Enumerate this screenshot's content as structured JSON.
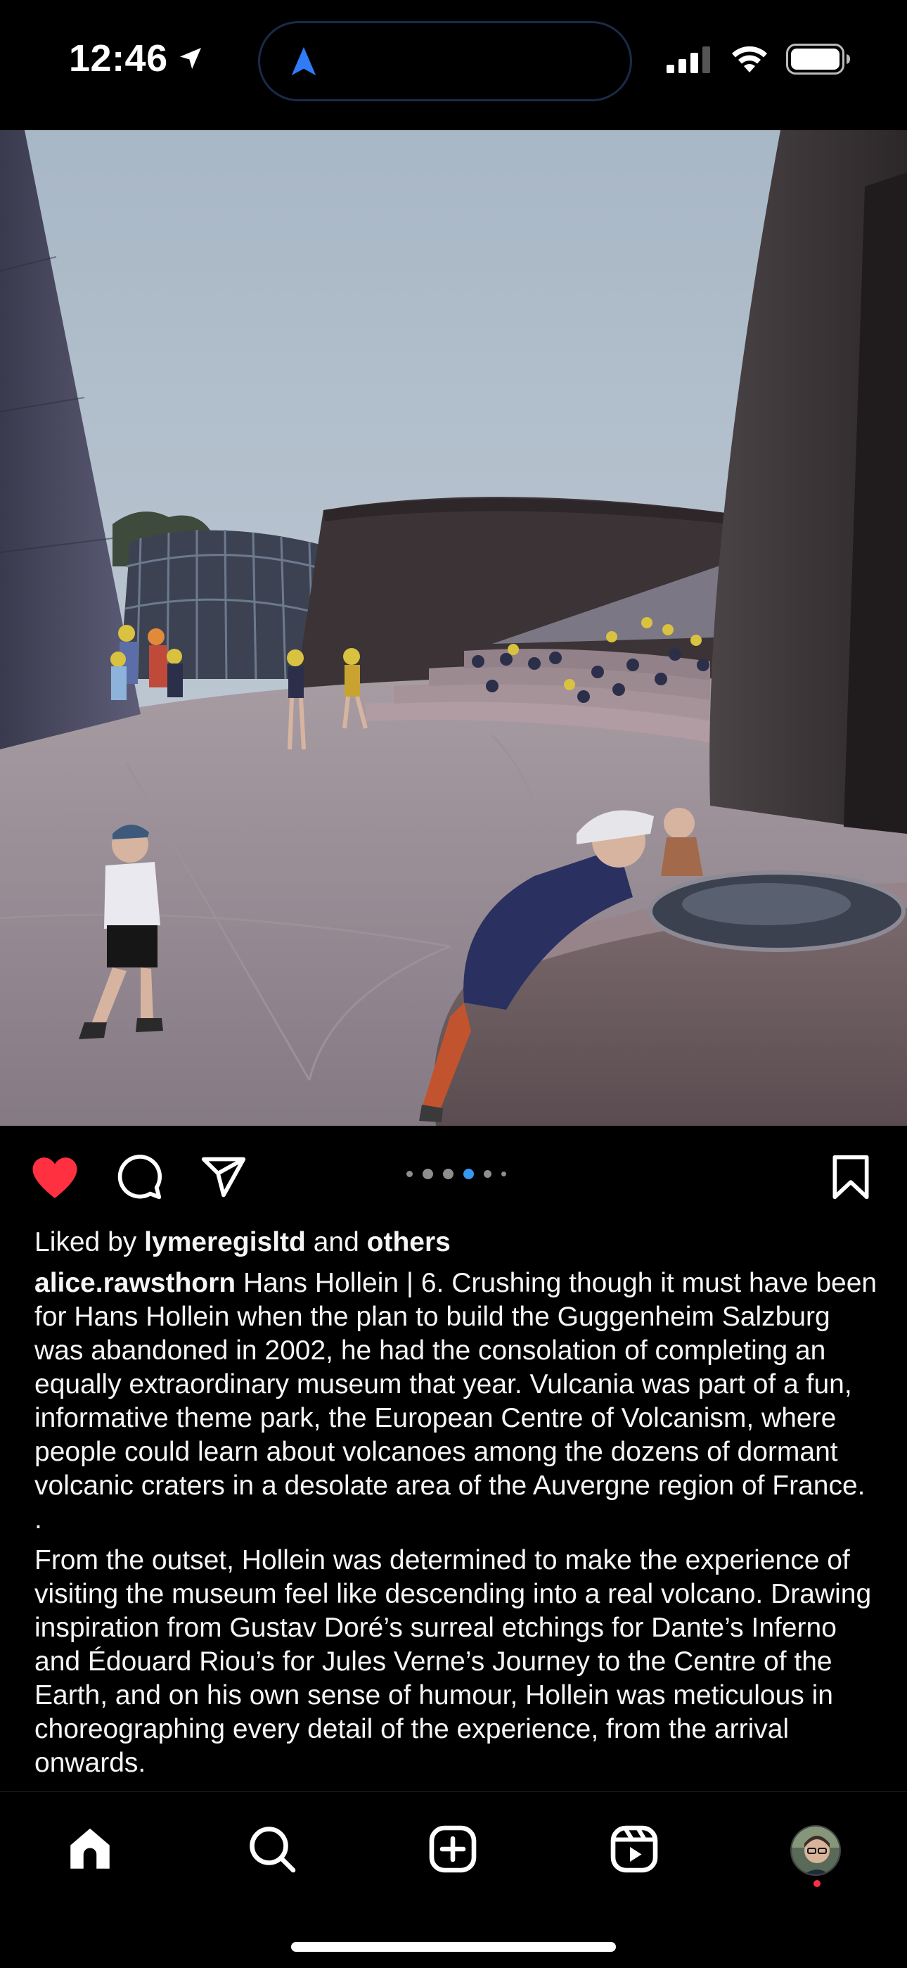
{
  "status_bar": {
    "time": "12:46",
    "location_icon": "location-arrow-icon",
    "island_icon": "navigation-arrow-icon",
    "signal_icon": "cellular-signal-icon",
    "wifi_icon": "wifi-icon",
    "battery_icon": "battery-icon"
  },
  "post": {
    "image_description_icon": "photo",
    "carousel": {
      "total": 6,
      "active_index": 3
    },
    "actions": {
      "liked": true,
      "like_color": "#ff3040",
      "icons": [
        "heart-icon",
        "comment-icon",
        "share-icon",
        "bookmark-icon"
      ]
    },
    "likes": {
      "prefix": "Liked by",
      "user": "lymeregisltd",
      "joiner": "and",
      "others": "others"
    },
    "caption": {
      "username": "alice.rawsthorn",
      "paragraph_1": "Hans Hollein | 6. Crushing though it must have been for Hans Hollein when the plan to build the Guggenheim Salzburg was abandoned in 2002, he had the consolation of completing an equally extraordinary museum that year. Vulcania was part of a fun, informative theme park, the European Centre of Volcanism, where people could learn about volcanoes among the dozens of dormant volcanic craters in a desolate area of the Auvergne region of France.",
      "separator": ".",
      "paragraph_2": "From the outset, Hollein was determined to make the experience of visiting the museum feel like descending into a real volcano. Drawing inspiration from Gustav Doré’s surreal etchings for Dante’s Inferno and Édouard Riou’s for Jules Verne’s Journey to the Centre of the Earth, and on his own sense of humour, Hollein was meticulous in choreographing every detail of the experience, from the arrival onwards."
    }
  },
  "tab_bar": {
    "items": [
      {
        "name": "home",
        "icon": "home-icon"
      },
      {
        "name": "search",
        "icon": "search-icon"
      },
      {
        "name": "create",
        "icon": "plus-square-icon"
      },
      {
        "name": "reels",
        "icon": "reels-icon"
      },
      {
        "name": "profile",
        "icon": "avatar"
      }
    ],
    "notification_color": "#ff3040"
  }
}
